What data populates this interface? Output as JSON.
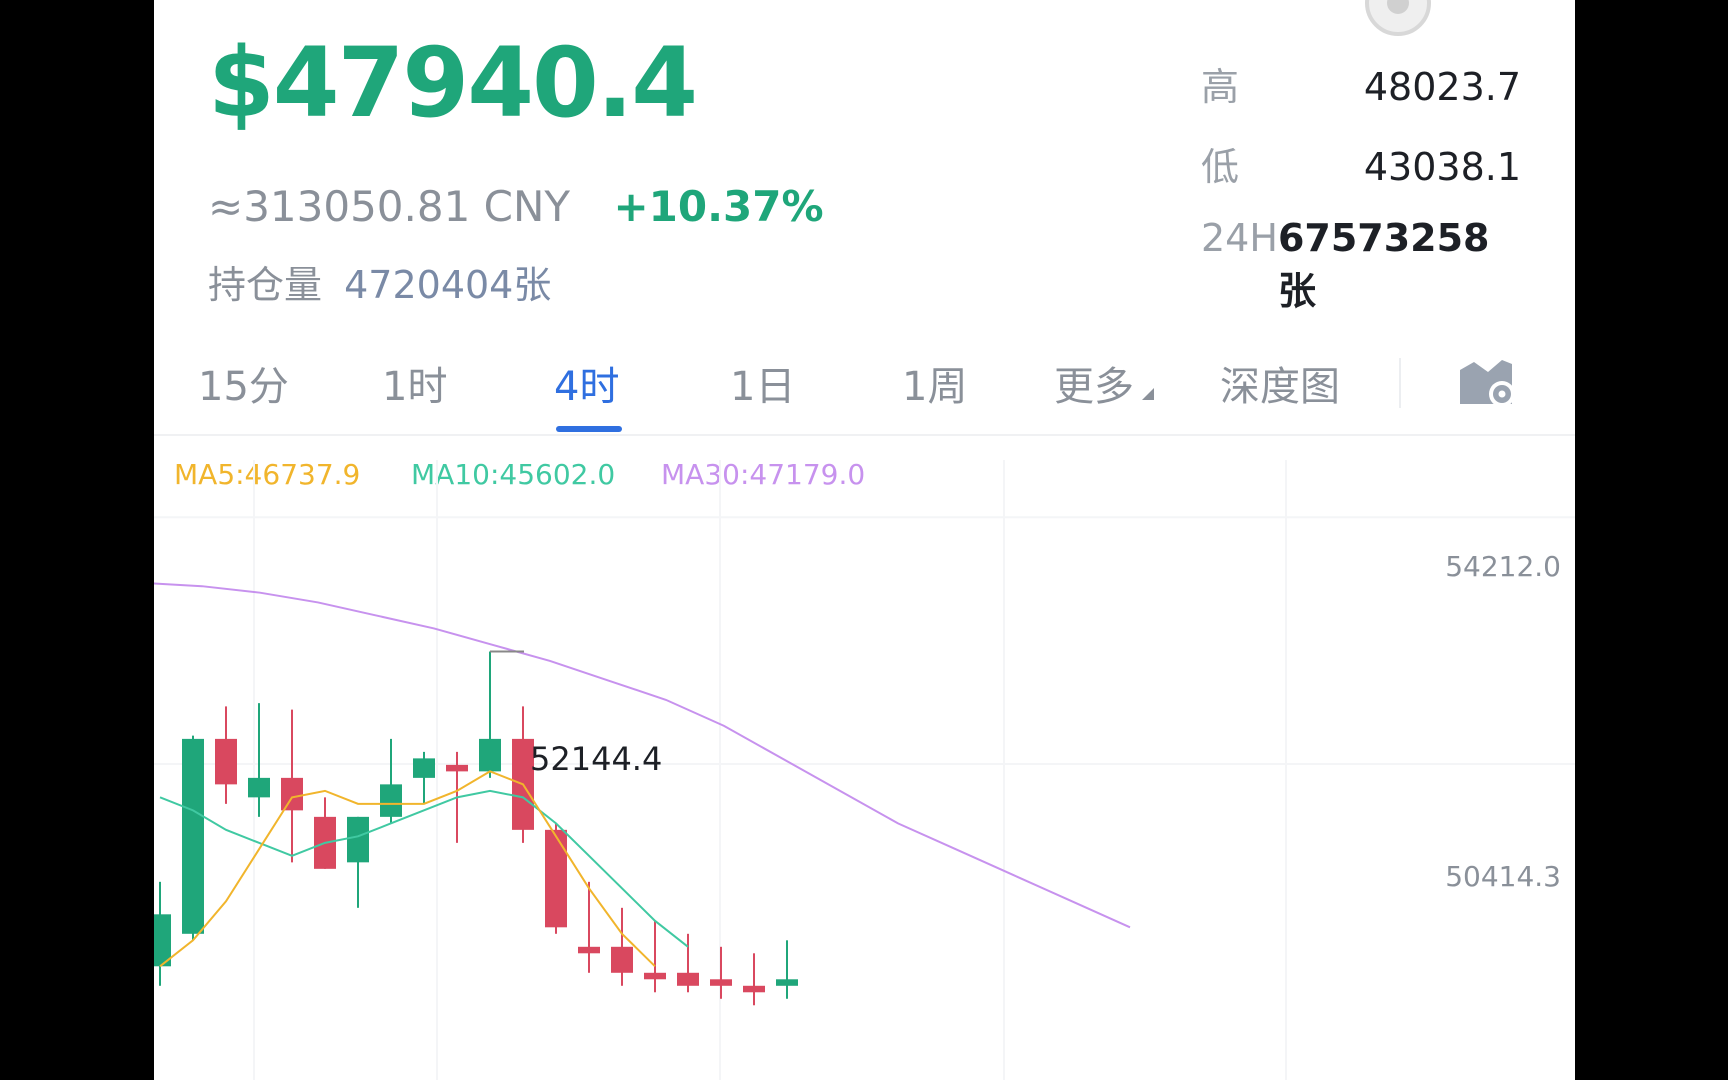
{
  "header": {
    "price": "$47940.4",
    "cny_equiv": "≈313050.81 CNY",
    "change": "+10.37%",
    "open_interest_label": "持仓量",
    "open_interest_value": "4720404张"
  },
  "stats": {
    "high_label": "高",
    "high_value": "48023.7",
    "low_label": "低",
    "low_value": "43038.1",
    "vol_label": "24H",
    "vol_value": "67573258张"
  },
  "tabs": {
    "t15m": "15分",
    "t1h": "1时",
    "t4h": "4时",
    "t1d": "1日",
    "t1w": "1周",
    "more": "更多",
    "depth": "深度图",
    "active": "4时"
  },
  "indicators": {
    "ma5": "MA5:46737.9",
    "ma10": "MA10:45602.0",
    "ma30": "MA30:47179.0"
  },
  "colors": {
    "up": "#1fa67a",
    "down": "#d9485f",
    "ma5": "#f1b52c",
    "ma10": "#40c9a2",
    "ma30": "#c792ee",
    "accent": "#2f6fe0"
  },
  "chart_data": {
    "type": "candlestick",
    "y_axis_labels": [
      "54212.0",
      "50414.3"
    ],
    "high_marker": "52144.4",
    "candles": [
      {
        "o": 47300,
        "c": 48100,
        "h": 48600,
        "l": 47000
      },
      {
        "o": 47800,
        "c": 50800,
        "h": 50850,
        "l": 47700
      },
      {
        "o": 50800,
        "c": 50100,
        "h": 51300,
        "l": 49800
      },
      {
        "o": 49900,
        "c": 50200,
        "h": 51350,
        "l": 49600
      },
      {
        "o": 50200,
        "c": 49700,
        "h": 51250,
        "l": 48900
      },
      {
        "o": 49600,
        "c": 48800,
        "h": 49900,
        "l": 48800
      },
      {
        "o": 48900,
        "c": 49600,
        "h": 49600,
        "l": 48200
      },
      {
        "o": 49600,
        "c": 50100,
        "h": 50800,
        "l": 49500
      },
      {
        "o": 50200,
        "c": 50500,
        "h": 50600,
        "l": 49800
      },
      {
        "o": 50400,
        "c": 50300,
        "h": 50600,
        "l": 49200
      },
      {
        "o": 50300,
        "c": 50800,
        "h": 52144.4,
        "l": 50200
      },
      {
        "o": 50800,
        "c": 49400,
        "h": 51300,
        "l": 49200
      },
      {
        "o": 49400,
        "c": 47900,
        "h": 49500,
        "l": 47800
      },
      {
        "o": 47600,
        "c": 47500,
        "h": 48600,
        "l": 47200
      },
      {
        "o": 47600,
        "c": 47200,
        "h": 48200,
        "l": 47000
      },
      {
        "o": 47200,
        "c": 47100,
        "h": 48000,
        "l": 46900
      },
      {
        "o": 47200,
        "c": 47000,
        "h": 47800,
        "l": 46900
      },
      {
        "o": 47100,
        "c": 47000,
        "h": 47600,
        "l": 46800
      },
      {
        "o": 47000,
        "c": 46900,
        "h": 47500,
        "l": 46700
      },
      {
        "o": 47000,
        "c": 47100,
        "h": 47700,
        "l": 46800
      }
    ],
    "ma5": [
      47300,
      47700,
      48300,
      49100,
      49900,
      50000,
      49800,
      49800,
      49800,
      50000,
      50300,
      50100,
      49300,
      48500,
      47800,
      47300
    ],
    "ma10": [
      49900,
      49700,
      49400,
      49200,
      49000,
      49200,
      49300,
      49500,
      49700,
      49900,
      50000,
      49900,
      49500,
      49000,
      48500,
      48000,
      47600
    ],
    "ma30": [
      53200,
      53150,
      53050,
      52900,
      52700,
      52500,
      52250,
      52000,
      51700,
      51400,
      51000,
      50500,
      50000,
      49500,
      49100,
      48700,
      48300,
      47900
    ]
  }
}
